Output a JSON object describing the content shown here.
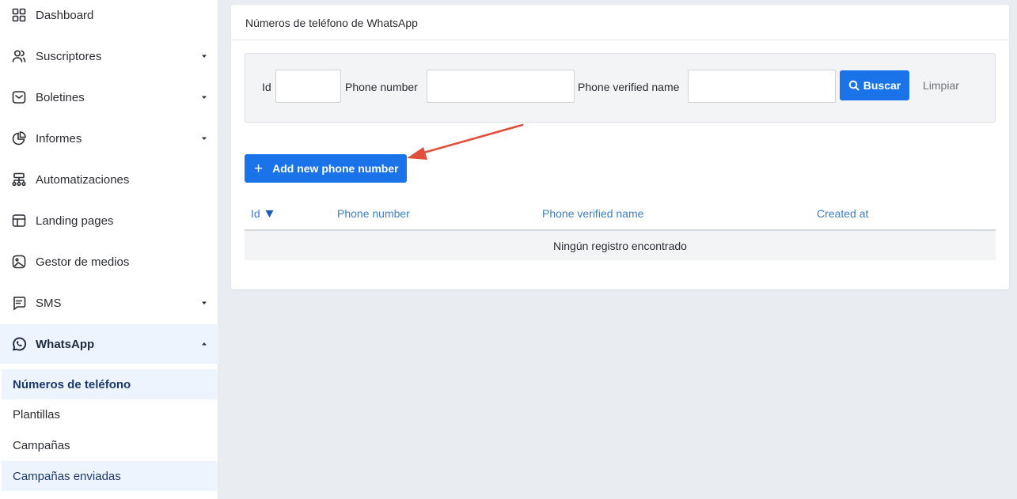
{
  "sidebar": {
    "items": [
      {
        "label": "Dashboard",
        "icon": "dashboard-icon",
        "has_caret": false
      },
      {
        "label": "Suscriptores",
        "icon": "users-icon",
        "has_caret": true
      },
      {
        "label": "Boletines",
        "icon": "newsletter-icon",
        "has_caret": true
      },
      {
        "label": "Informes",
        "icon": "pie-chart-icon",
        "has_caret": true
      },
      {
        "label": "Automatizaciones",
        "icon": "automation-icon",
        "has_caret": false
      },
      {
        "label": "Landing pages",
        "icon": "layout-icon",
        "has_caret": false
      },
      {
        "label": "Gestor de medios",
        "icon": "media-icon",
        "has_caret": false
      },
      {
        "label": "SMS",
        "icon": "sms-icon",
        "has_caret": true
      },
      {
        "label": "WhatsApp",
        "icon": "whatsapp-icon",
        "has_caret": true,
        "expanded": true
      }
    ],
    "sub_items": [
      {
        "label": "Números de teléfono",
        "state": "current"
      },
      {
        "label": "Plantillas",
        "state": "normal"
      },
      {
        "label": "Campañas",
        "state": "normal"
      },
      {
        "label": "Campañas enviadas",
        "state": "hover"
      }
    ]
  },
  "card": {
    "title": "Números de teléfono de WhatsApp"
  },
  "filters": {
    "id_label": "Id",
    "id_value": "",
    "phone_label": "Phone number",
    "phone_value": "",
    "verified_label": "Phone verified name",
    "verified_value": "",
    "search_label": "Buscar",
    "clear_label": "Limpiar"
  },
  "actions": {
    "add_label": "Add new phone number"
  },
  "table": {
    "columns": [
      "Id",
      "Phone number",
      "Phone verified name",
      "Created at"
    ],
    "sort_column": "Id",
    "empty_text": "Ningún registro encontrado"
  },
  "colors": {
    "primary": "#1a73e8",
    "link": "#3e7fc1",
    "annotation_arrow": "#e0503c",
    "active_bg": "#eef4fd"
  }
}
